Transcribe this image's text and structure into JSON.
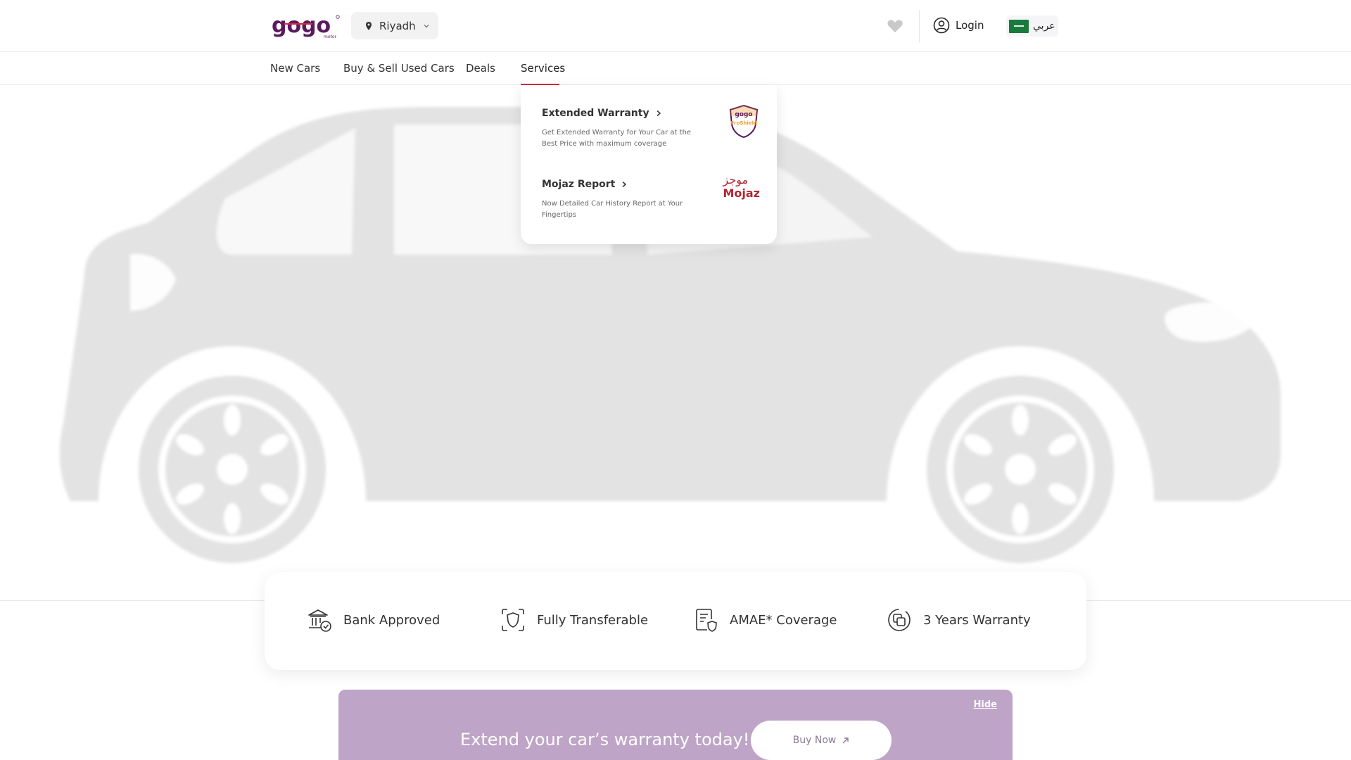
{
  "header": {
    "logo_text": "gogo",
    "logo_subtext": "motor",
    "city": "Riyadh",
    "login_label": "Login",
    "language_label": "عربي"
  },
  "nav": {
    "items": [
      {
        "label": "New Cars"
      },
      {
        "label": "Buy & Sell Used Cars"
      },
      {
        "label": "Deals"
      },
      {
        "label": "Services",
        "active": true
      }
    ]
  },
  "services_menu": {
    "items": [
      {
        "title": "Extended Warranty",
        "description": "Get Extended Warranty for Your Car at the Best Price with maximum coverage",
        "logo_top": "gogo",
        "logo_bottom": "ProShield"
      },
      {
        "title": "Mojaz Report",
        "description": "Now Detailed Car History Report at Your Fingertips",
        "logo_arabic": "موجز",
        "logo_english": "Mojaz"
      }
    ]
  },
  "features": [
    {
      "label": "Bank Approved",
      "icon": "bank-check-icon"
    },
    {
      "label": "Fully Transferable",
      "icon": "shield-scan-icon"
    },
    {
      "label": "AMAE* Coverage",
      "icon": "document-shield-icon"
    },
    {
      "label": "3 Years Warranty",
      "icon": "layered-squares-icon"
    }
  ],
  "banner": {
    "hide_label": "Hide",
    "text": "Extend your car’s warranty today!",
    "button_label": "Buy Now"
  },
  "colors": {
    "accent_red": "#d32a3c",
    "brand_purple": "#5a1a5e",
    "banner_bg": "#bea4c6"
  }
}
